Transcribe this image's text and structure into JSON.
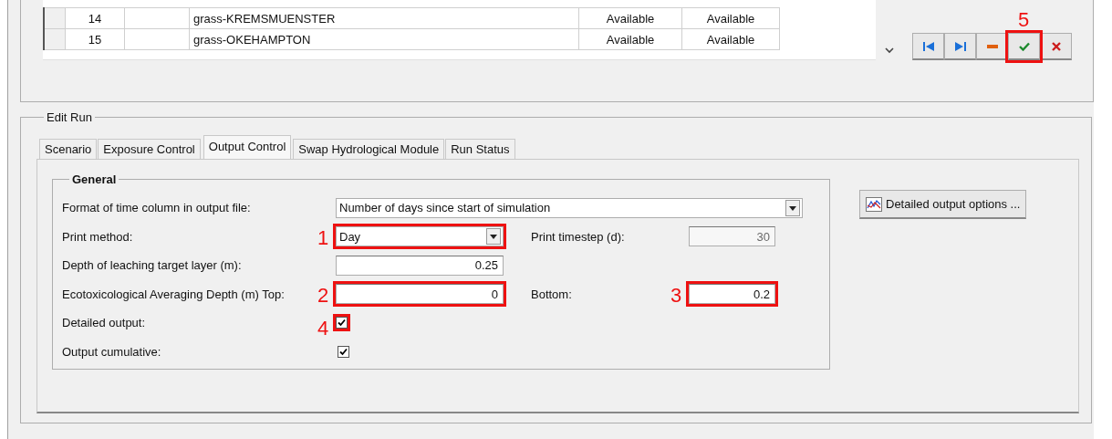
{
  "table": {
    "rows": [
      {
        "cells": [
          "14",
          "",
          "grass-KREMSMUENSTER",
          "Available",
          "Available"
        ]
      },
      {
        "cells": [
          "15",
          "",
          "grass-OKEHAMPTON",
          "Available",
          "Available"
        ]
      }
    ]
  },
  "nav_buttons": [
    {
      "kind": "first"
    },
    {
      "kind": "last"
    },
    {
      "kind": "delete"
    },
    {
      "kind": "post",
      "annotation": "5"
    },
    {
      "kind": "cancel"
    }
  ],
  "edit_run": {
    "title": "Edit Run",
    "tabs": [
      {
        "label": "Scenario",
        "selected": false
      },
      {
        "label": "Exposure Control",
        "selected": false
      },
      {
        "label": "Output Control",
        "selected": true
      },
      {
        "label": "Swap Hydrological Module",
        "selected": false
      },
      {
        "label": "Run Status",
        "selected": false
      }
    ],
    "general": {
      "title": "General",
      "time_format": {
        "label": "Format of time column in output file:",
        "value": "Number of days since start of simulation"
      },
      "print_method": {
        "label": "Print method:",
        "value": "Day",
        "annotation": "1"
      },
      "print_timestep": {
        "label": "Print timestep (d):",
        "value": "30",
        "disabled": true
      },
      "leaching_depth": {
        "label": "Depth of leaching target layer (m):",
        "value": "0.25"
      },
      "eco_top": {
        "label": "Ecotoxicological Averaging Depth (m) Top:",
        "value": "0",
        "annotation": "2"
      },
      "eco_bottom": {
        "label": "Bottom:",
        "value": "0.2",
        "annotation": "3"
      },
      "detailed_output": {
        "label": "Detailed output:",
        "checked": true,
        "annotation": "4"
      },
      "output_cumulative": {
        "label": "Output cumulative:",
        "checked": true
      }
    },
    "detailed_button": "Detailed output options ..."
  }
}
